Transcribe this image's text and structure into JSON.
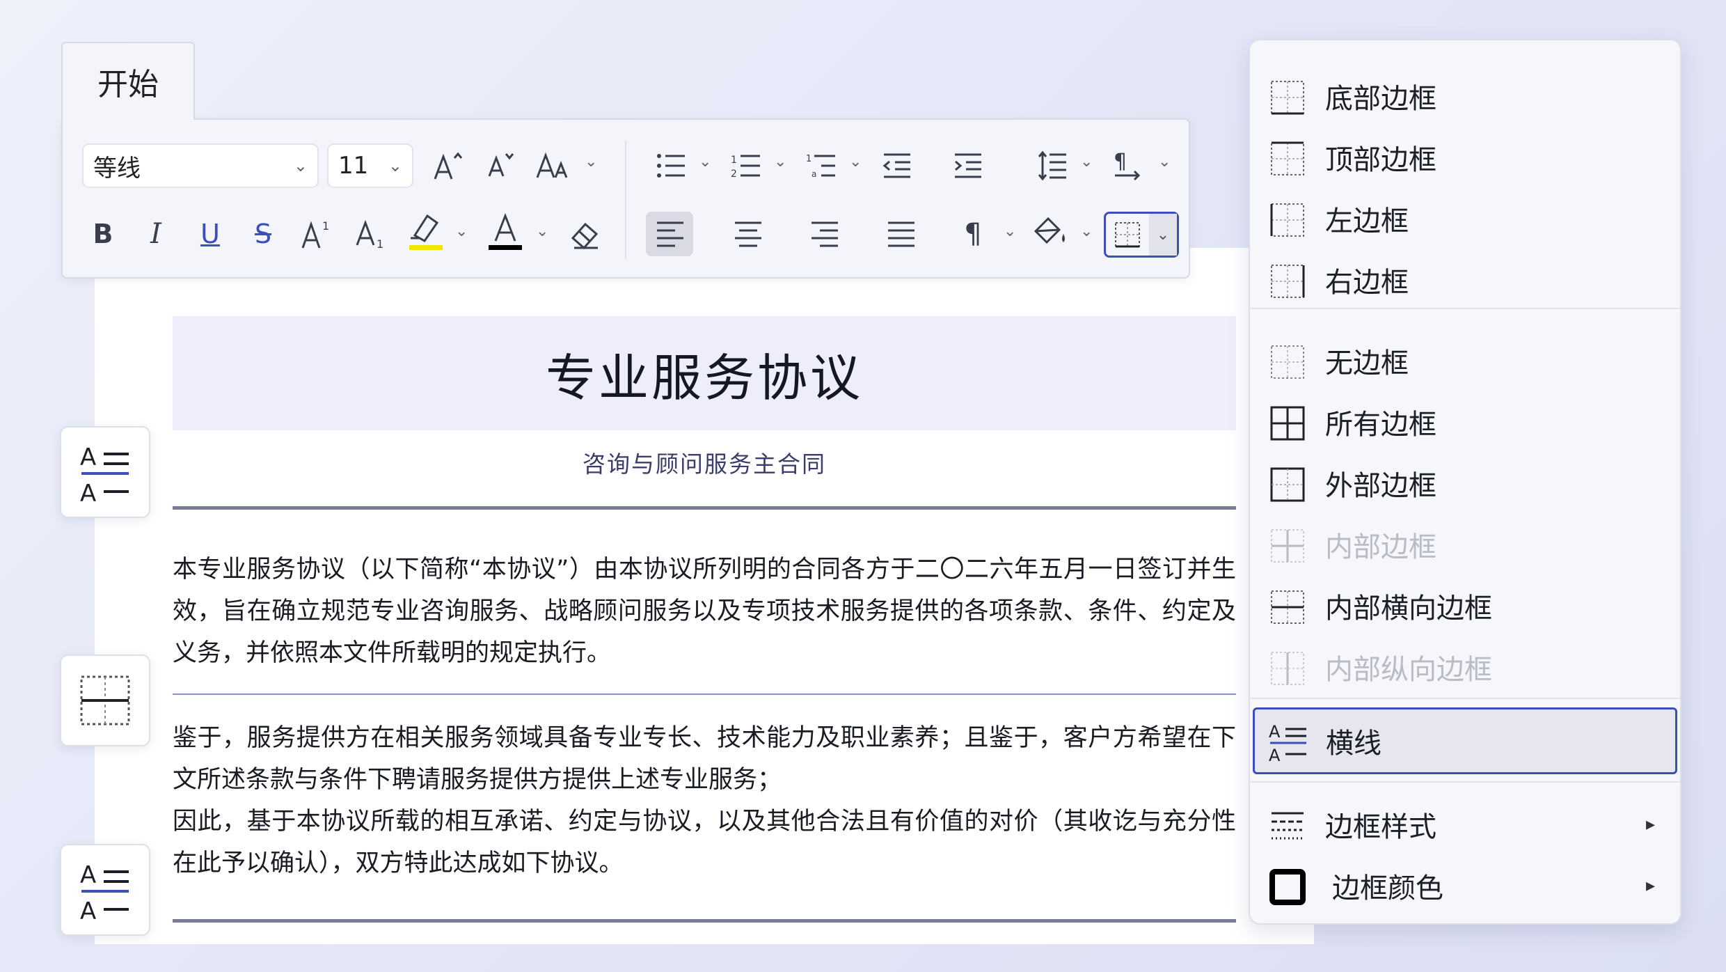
{
  "ribbon": {
    "tab_label": "开始",
    "font_name": "等线",
    "font_size": "11"
  },
  "document": {
    "title": "专业服务协议",
    "subtitle": "咨询与顾问服务主合同",
    "paragraph1": "本专业服务协议（以下简称“本协议”）由本协议所列明的合同各方于二〇二六年五月一日签订并生效，旨在确立规范专业咨询服务、战略顾问服务以及专项技术服务提供的各项条款、条件、约定及义务，并依照本文件所载明的规定执行。",
    "paragraph2a": "鉴于，服务提供方在相关服务领域具备专业专长、技术能力及职业素养；且鉴于，客户方希望在下文所述条款与条件下聘请服务提供方提供上述专业服务；",
    "paragraph2b": "因此，基于本协议所载的相互承诺、约定与协议，以及其他合法且有价值的对价（其收讫与充分性在此予以确认），双方特此达成如下协议。"
  },
  "border_menu": {
    "items": [
      {
        "label": "底部边框",
        "icon": "border-bottom-icon",
        "disabled": false
      },
      {
        "label": "顶部边框",
        "icon": "border-top-icon",
        "disabled": false
      },
      {
        "label": "左边框",
        "icon": "border-left-icon",
        "disabled": false
      },
      {
        "label": "右边框",
        "icon": "border-right-icon",
        "disabled": false
      },
      {
        "label": "无边框",
        "icon": "border-none-icon",
        "disabled": false
      },
      {
        "label": "所有边框",
        "icon": "border-all-icon",
        "disabled": false
      },
      {
        "label": "外部边框",
        "icon": "border-outside-icon",
        "disabled": false
      },
      {
        "label": "内部边框",
        "icon": "border-inside-icon",
        "disabled": true
      },
      {
        "label": "内部横向边框",
        "icon": "border-inside-horizontal-icon",
        "disabled": false
      },
      {
        "label": "内部纵向边框",
        "icon": "border-inside-vertical-icon",
        "disabled": true
      },
      {
        "label": "横线",
        "icon": "horizontal-line-icon",
        "disabled": false,
        "selected": true
      },
      {
        "label": "边框样式",
        "icon": "border-style-icon",
        "disabled": false,
        "submenu": true
      },
      {
        "label": "边框颜色",
        "icon": "border-color-icon",
        "disabled": false,
        "submenu": true
      }
    ]
  },
  "colors": {
    "accent": "#3c4fb8",
    "highlight": "#f2e600",
    "font_color": "#000000",
    "title_band": "#ededfb"
  }
}
